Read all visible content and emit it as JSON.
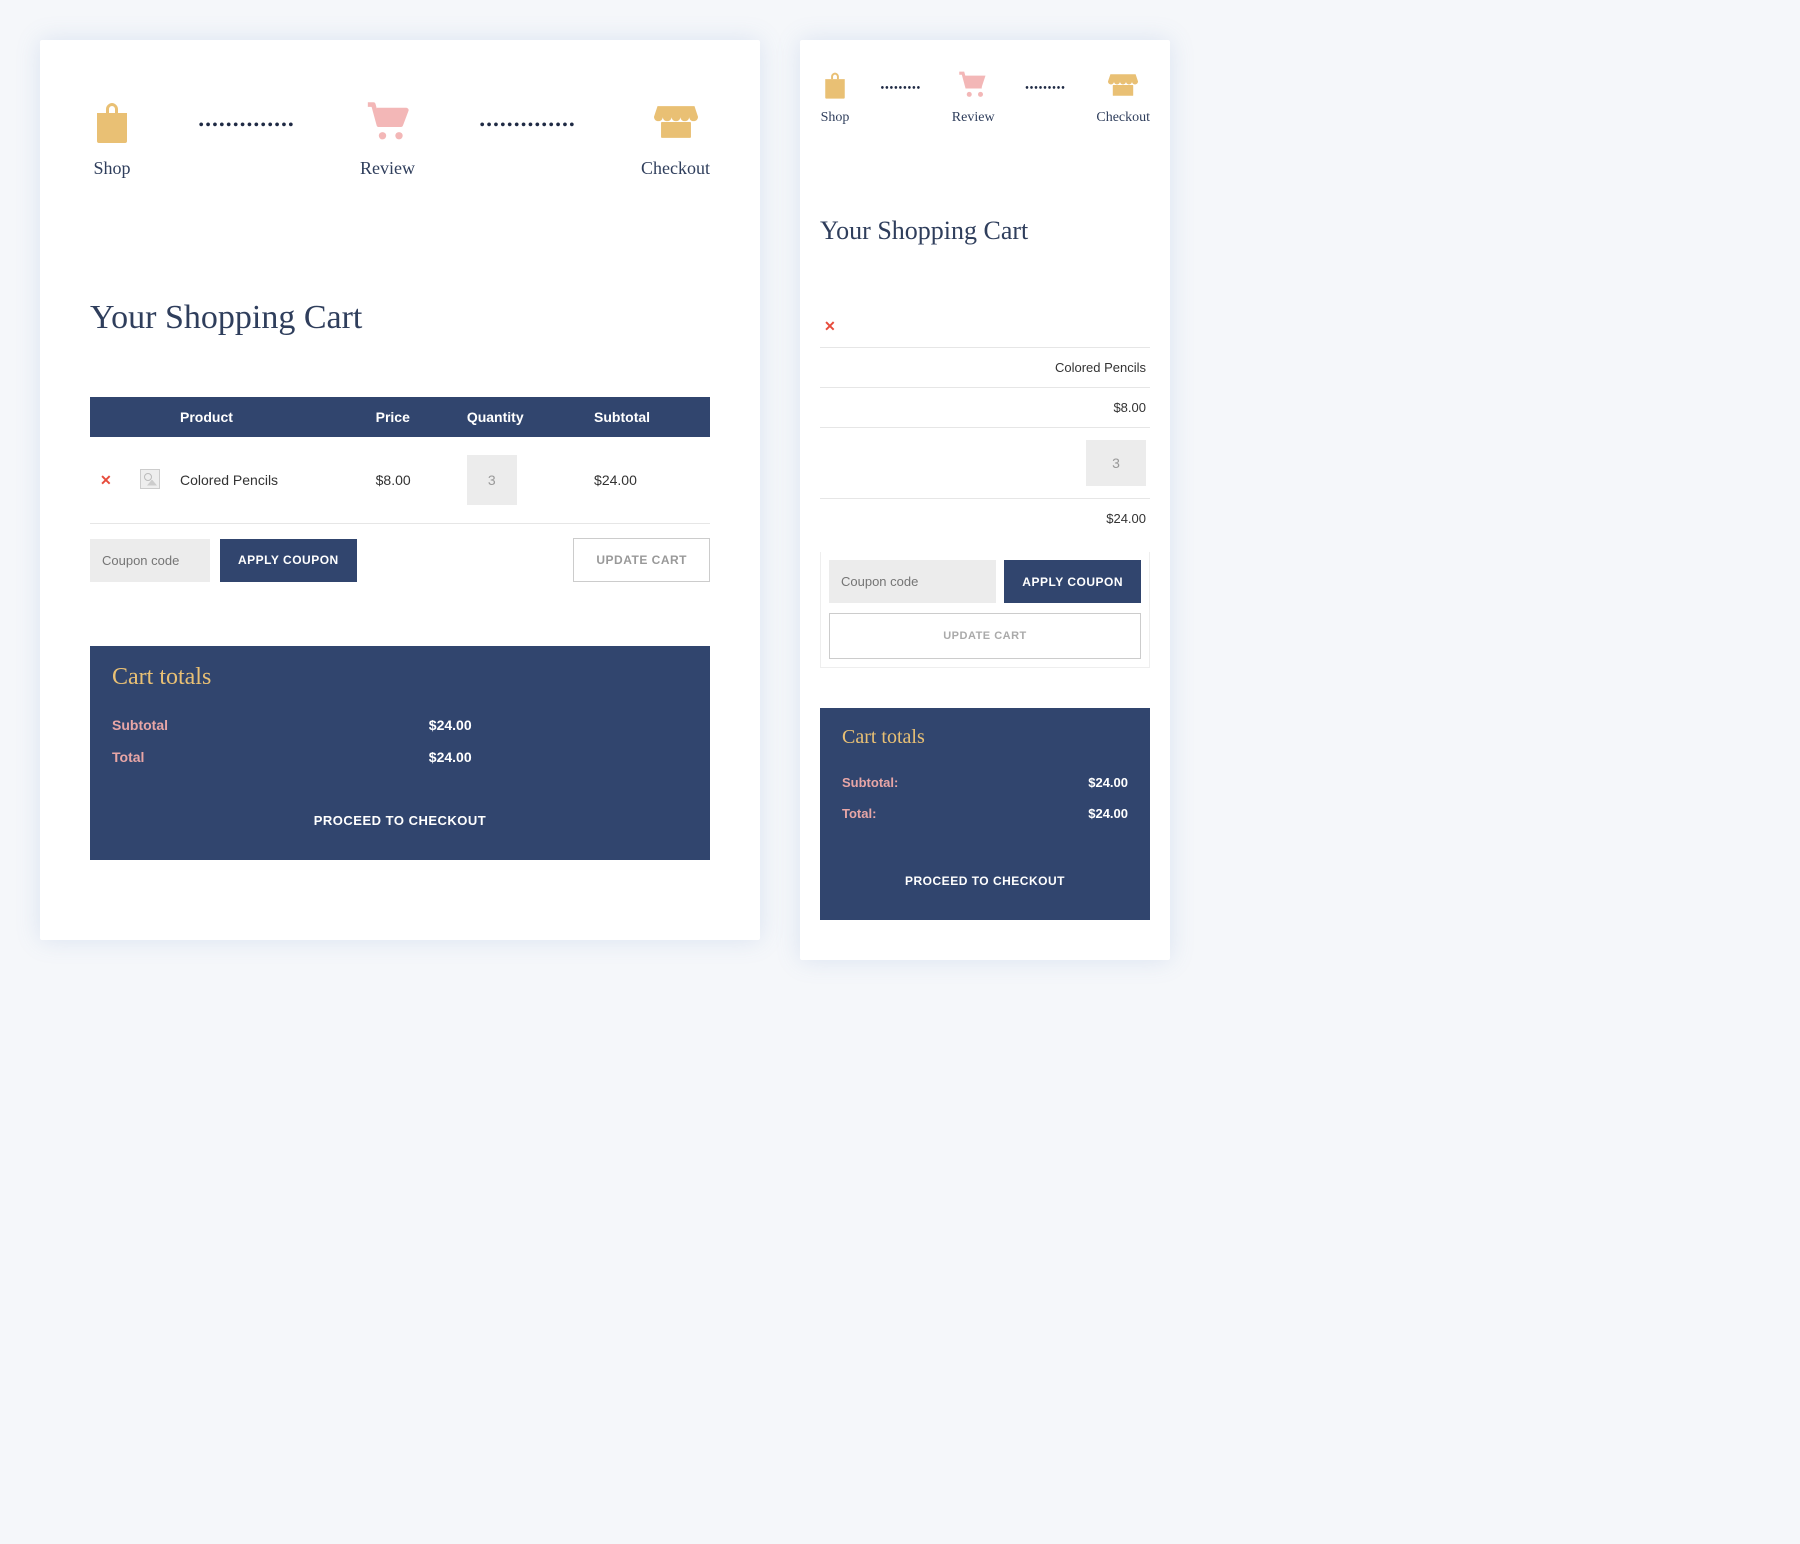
{
  "stepper": {
    "shop": "Shop",
    "review": "Review",
    "checkout": "Checkout"
  },
  "title": "Your Shopping Cart",
  "table": {
    "headers": {
      "product": "Product",
      "price": "Price",
      "quantity": "Quantity",
      "subtotal": "Subtotal"
    },
    "item": {
      "name": "Colored Pencils",
      "price": "$8.00",
      "quantity": "3",
      "subtotal": "$24.00"
    }
  },
  "coupon": {
    "placeholder": "Coupon code",
    "apply": "APPLY COUPON",
    "update": "UPDATE CART"
  },
  "totals": {
    "heading": "Cart totals",
    "subtotal_label": "Subtotal",
    "subtotal_label_m": "Subtotal:",
    "subtotal_value": "$24.00",
    "total_label": "Total",
    "total_label_m": "Total:",
    "total_value": "$24.00",
    "checkout": "PROCEED TO CHECKOUT"
  },
  "mobile": {
    "price": "$8.00",
    "subtotal": "$24.00"
  }
}
